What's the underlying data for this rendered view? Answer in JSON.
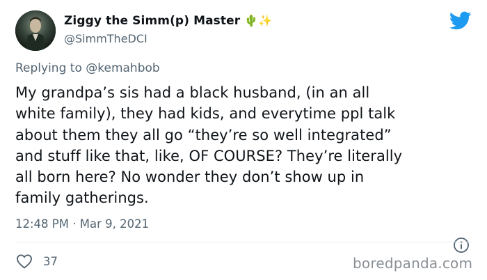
{
  "user": {
    "display_name": "Ziggy the Simm(p) Master",
    "emoji": "🌵✨",
    "handle": "@SimmTheDCI"
  },
  "reply": {
    "prefix": "Replying to ",
    "mention": "@kemahbob"
  },
  "tweet": {
    "lines": [
      "My grandpa’s sis had a black husband, (in an all",
      "white family), they had kids, and everytime ppl talk",
      "about them they all go “they’re so well integrated”",
      "and stuff like that, like, OF COURSE? They’re literally",
      "all born here? No wonder they don’t show up in",
      "family gatherings."
    ],
    "timestamp": "12:48 PM · Mar 9, 2021",
    "likes": "37"
  },
  "icons": {
    "brand": "twitter-bird-icon",
    "info": "info-icon",
    "like": "heart-icon"
  },
  "colors": {
    "twitter_blue": "#1d9bf0",
    "text": "#0f1419",
    "secondary": "#536471"
  },
  "watermark": "boredpanda.com"
}
